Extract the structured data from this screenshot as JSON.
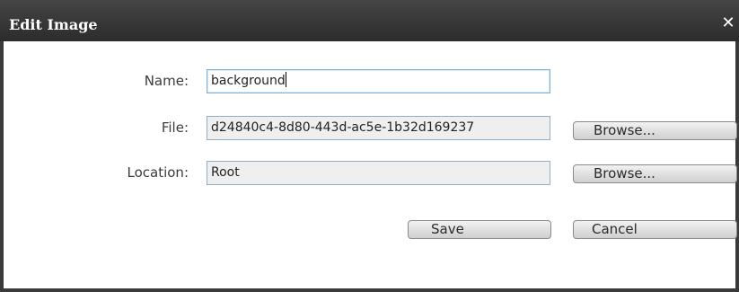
{
  "dialog": {
    "title": "Edit Image",
    "close_glyph": "✕",
    "close_icon": "close-icon"
  },
  "form": {
    "name_label": "Name:",
    "name_value": "background",
    "file_label": "File:",
    "file_value": "d24840c4-8d80-443d-ac5e-1b32d169237",
    "location_label": "Location:",
    "location_value": "Root"
  },
  "buttons": {
    "browse_file": "Browse...",
    "browse_location": "Browse...",
    "save": "Save",
    "cancel": "Cancel"
  }
}
